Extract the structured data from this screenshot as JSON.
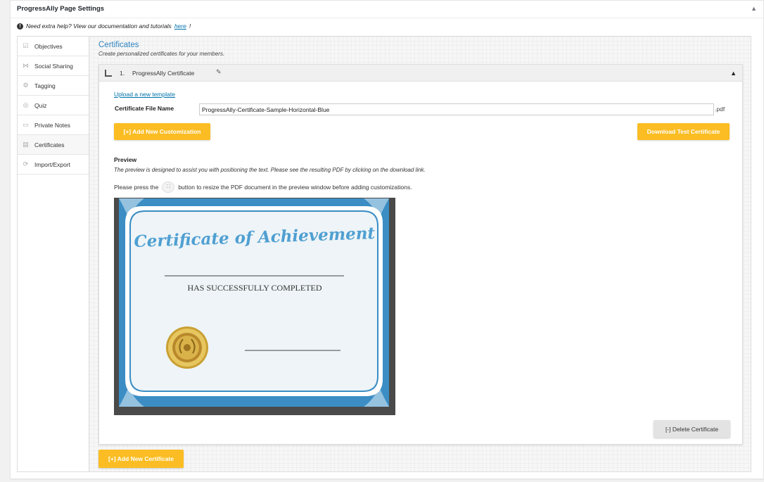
{
  "panel": {
    "title": "ProgressAlly Page Settings",
    "toggle_glyph": "▲",
    "help_icon_glyph": "!",
    "help_text": "Need extra help? View our documentation and tutorials ",
    "help_link": "here",
    "help_suffix": "!"
  },
  "sidebar": {
    "items": [
      {
        "label": "Objectives",
        "icon": "checkbox-icon",
        "glyph": "☑"
      },
      {
        "label": "Social Sharing",
        "icon": "share-icon",
        "glyph": "⋈"
      },
      {
        "label": "Tagging",
        "icon": "tag-icon",
        "glyph": "⚙"
      },
      {
        "label": "Quiz",
        "icon": "quiz-icon",
        "glyph": "◎"
      },
      {
        "label": "Private Notes",
        "icon": "notes-icon",
        "glyph": "▭"
      },
      {
        "label": "Certificates",
        "icon": "certificate-icon",
        "glyph": "▤"
      },
      {
        "label": "Import/Export",
        "icon": "sync-icon",
        "glyph": "⟳"
      }
    ],
    "active_index": 5
  },
  "content": {
    "title": "Certificates",
    "subtitle": "Create personalized certificates for your members."
  },
  "certificate": {
    "number": "1.",
    "name": "ProgressAlly Certificate",
    "edit_glyph": "✎",
    "collapse_glyph": "▲",
    "upload_link": "Upload a new template",
    "file_name_label": "Certificate File Name",
    "file_name_value": "ProgressAlly-Certificate-Sample-Horizontal-Blue",
    "file_ext": ".pdf",
    "add_customization_label": "[+] Add New Customization",
    "download_label": "Download Test Certificate",
    "preview_label": "Preview",
    "preview_desc": "The preview is designed to assist you with positioning the text. Please see the resulting PDF by clicking on the download link.",
    "press_prefix": "Please press the",
    "press_suffix": "button to resize the PDF document in the preview window before adding customizations.",
    "resize_glyph": "⛶",
    "delete_label": "[-] Delete Certificate"
  },
  "certificate_image": {
    "heading": "Certificate of Achievement",
    "completed_text": "HAS SUCCESSFULLY COMPLETED",
    "border_color": "#3b8dc4",
    "paper_color": "#eef4f7",
    "seal_color": "#c9a032"
  },
  "footer": {
    "add_certificate_label": "[+] Add New Certificate"
  },
  "colors": {
    "accent": "#fbbd23",
    "link": "#0073aa",
    "title_blue": "#2e85c1"
  }
}
